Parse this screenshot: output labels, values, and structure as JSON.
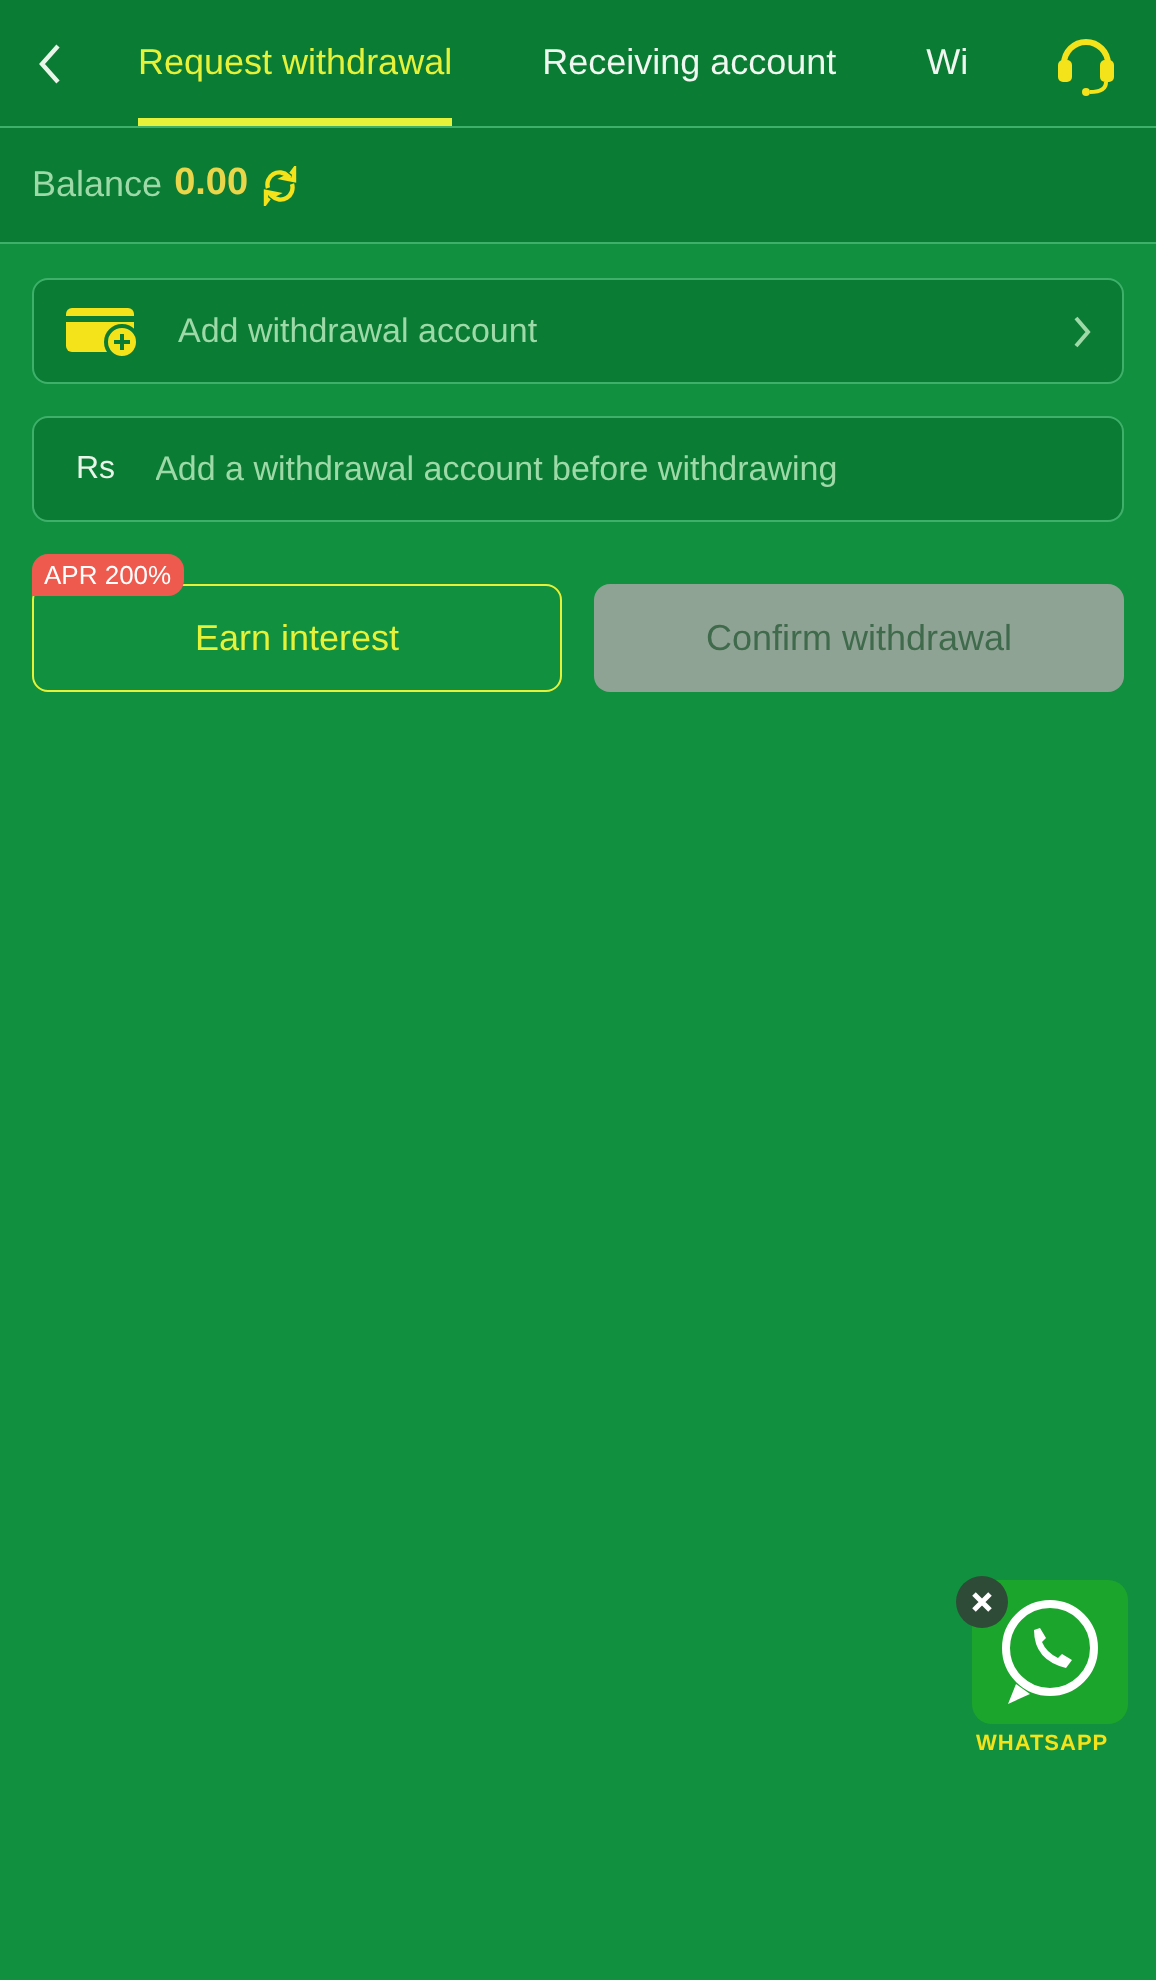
{
  "header": {
    "tabs": [
      {
        "label": "Request withdrawal",
        "selected": true
      },
      {
        "label": "Receiving account",
        "selected": false
      },
      {
        "label": "Wi",
        "selected": false
      }
    ]
  },
  "balance": {
    "label": "Balance",
    "amount": "0.00"
  },
  "account_row": {
    "label": "Add withdrawal account"
  },
  "amount_field": {
    "prefix": "Rs",
    "placeholder": "Add a withdrawal account before withdrawing"
  },
  "buttons": [
    {
      "label": "Earn interest",
      "badge": "APR 200%",
      "disabled": false
    },
    {
      "label": "Confirm withdrawal",
      "disabled": true
    }
  ],
  "whatsapp_widget": {
    "label": "WHATSAPP"
  }
}
